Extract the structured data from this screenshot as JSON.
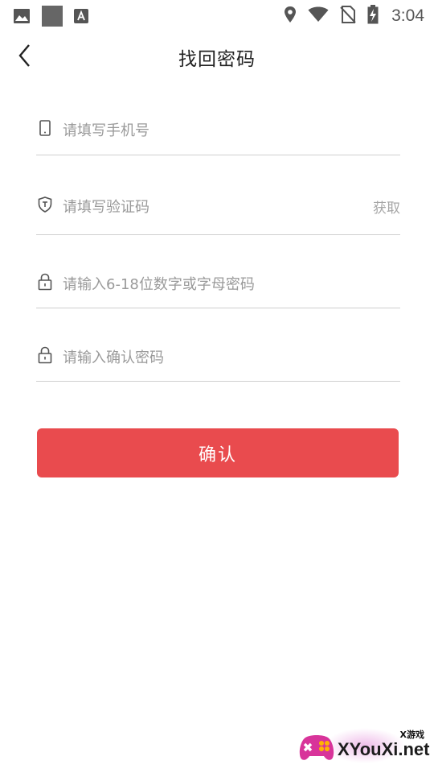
{
  "status_bar": {
    "time": "3:04",
    "left_icons": [
      "image-icon",
      "square-icon",
      "text-a-icon"
    ],
    "right_icons": [
      "location-icon",
      "wifi-icon",
      "no-sim-icon",
      "battery-charging-icon"
    ]
  },
  "header": {
    "title": "找回密码",
    "back_icon": "chevron-left-icon"
  },
  "form": {
    "phone": {
      "placeholder": "请填写手机号",
      "value": "",
      "icon": "phone-icon"
    },
    "code": {
      "placeholder": "请填写验证码",
      "value": "",
      "icon": "shield-icon",
      "get_code_label": "获取"
    },
    "password": {
      "placeholder": "请输入6-18位数字或字母密码",
      "value": "",
      "icon": "lock-icon"
    },
    "confirm_password": {
      "placeholder": "请输入确认密码",
      "value": "",
      "icon": "lock-icon"
    }
  },
  "confirm_button": {
    "label": "确认"
  },
  "watermark": {
    "small_text": "X游戏",
    "main_text": "XYouXi.net"
  },
  "colors": {
    "accent": "#e94b4e",
    "divider": "#cfcfcf",
    "placeholder": "#9a9a9a"
  }
}
